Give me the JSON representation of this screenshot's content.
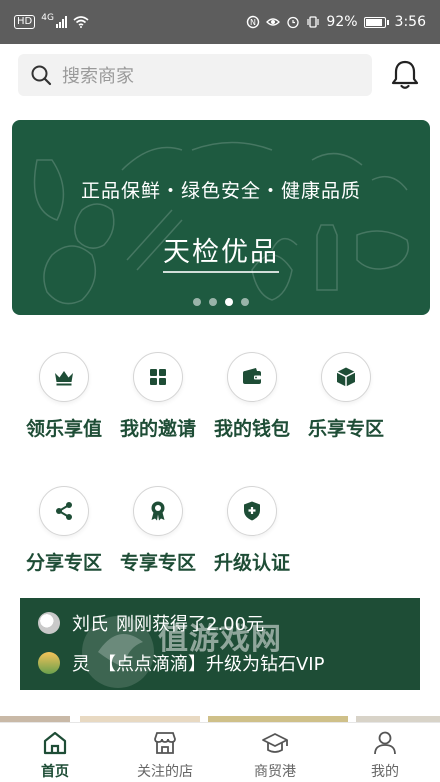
{
  "status_bar": {
    "network_badge": "HD",
    "network_type": "4G",
    "battery_percent": "92%",
    "time": "3:56"
  },
  "search": {
    "placeholder": "搜索商家"
  },
  "banner": {
    "slogan": "正品保鲜・绿色安全・健康品质",
    "title": "天检优品",
    "slide_count": 4,
    "active_slide": 3
  },
  "quick_menu": {
    "row1": [
      {
        "label": "领乐享值",
        "icon": "crown-icon"
      },
      {
        "label": "我的邀请",
        "icon": "grid-icon"
      },
      {
        "label": "我的钱包",
        "icon": "wallet-icon"
      },
      {
        "label": "乐享专区",
        "icon": "cube-icon"
      }
    ],
    "row2": [
      {
        "label": "分享专区",
        "icon": "share-icon"
      },
      {
        "label": "专享专区",
        "icon": "badge-icon"
      },
      {
        "label": "升级认证",
        "icon": "shield-plus-icon"
      }
    ]
  },
  "notices": [
    {
      "name": "刘氏",
      "message": "刚刚获得了2.00元"
    },
    {
      "name": "灵",
      "message": "【点点滴滴】升级为钻石VIP"
    }
  ],
  "watermark": {
    "text": "值游戏网"
  },
  "tabbar": [
    {
      "label": "首页",
      "icon": "home-icon",
      "active": true
    },
    {
      "label": "关注的店",
      "icon": "store-icon",
      "active": false
    },
    {
      "label": "商贸港",
      "icon": "graduation-icon",
      "active": false
    },
    {
      "label": "我的",
      "icon": "user-icon",
      "active": false
    }
  ],
  "colors": {
    "brand_green": "#1e4d36",
    "banner_green": "#1e5a40",
    "status_bar": "#5d5d5d"
  }
}
